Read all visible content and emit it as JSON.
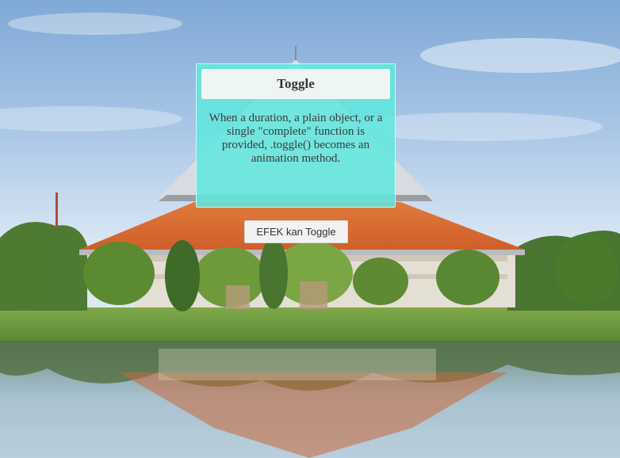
{
  "panel": {
    "title": "Toggle",
    "description": "When a duration, a plain object, or a single \"complete\" function is provided, .toggle() becomes an animation method.",
    "background_color": "#5fe8de"
  },
  "button": {
    "label": "EFEK kan Toggle"
  }
}
